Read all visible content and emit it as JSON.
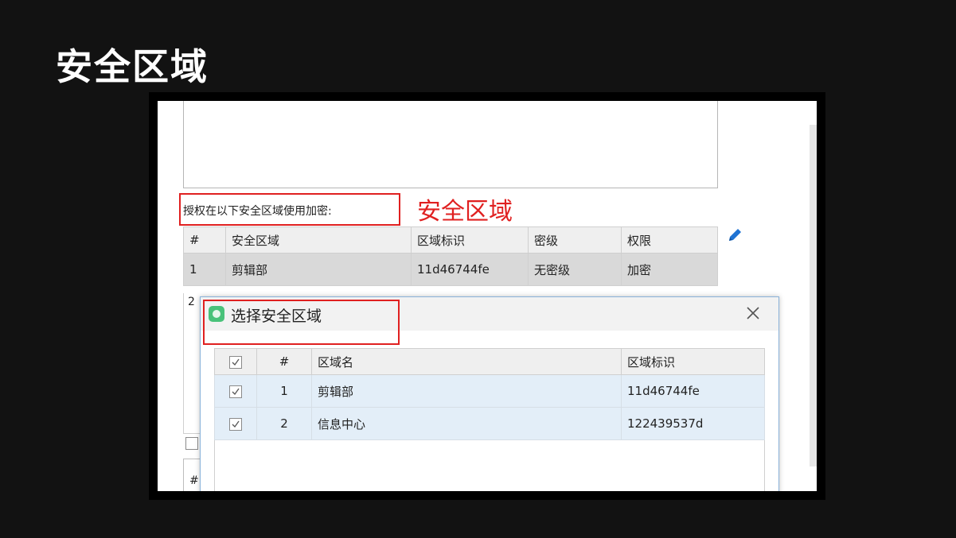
{
  "slide": {
    "title": "安全区域"
  },
  "screenshot": {
    "auth_label": "授权在以下安全区域使用加密:",
    "annotation": "安全区域",
    "pencil_icon": "pencil-icon",
    "main_table": {
      "headers": [
        "#",
        "安全区域",
        "区域标识",
        "密级",
        "权限"
      ],
      "rows": [
        [
          "1",
          "剪辑部",
          "11d46744fe",
          "无密级",
          "加密"
        ]
      ],
      "peek_row_number": "2"
    },
    "peek_hash": "#",
    "dialog": {
      "title": "选择安全区域",
      "app_icon": "app-icon",
      "close_icon": "close-icon",
      "table": {
        "headers": [
          "#",
          "区域名",
          "区域标识"
        ],
        "rows": [
          {
            "checked": true,
            "num": "1",
            "name": "剪辑部",
            "id": "11d46744fe"
          },
          {
            "checked": true,
            "num": "2",
            "name": "信息中心",
            "id": "122439537d"
          }
        ]
      }
    },
    "colors": {
      "annotation_red": "#e02020",
      "pencil_blue": "#1f73d3",
      "selection_blue": "#e3eef8"
    }
  }
}
